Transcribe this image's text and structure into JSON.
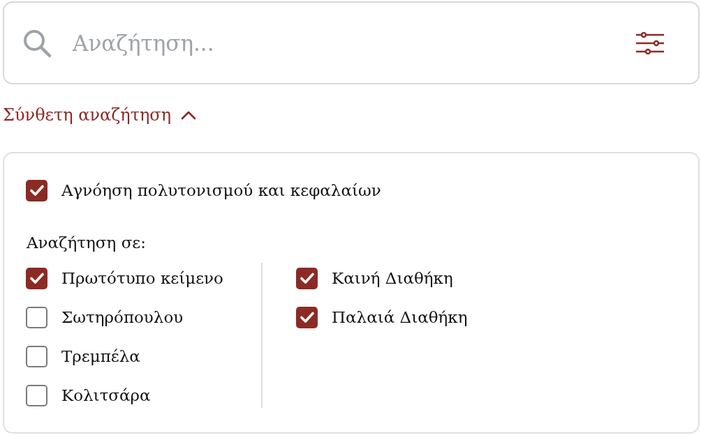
{
  "search": {
    "placeholder": "Αναζήτηση..."
  },
  "advanced_toggle": {
    "label": "Σύνθετη αναζήτηση",
    "expanded": true
  },
  "options": {
    "ignore_accents": {
      "label": "Αγνόηση πολυτονισμού και κεφαλαίων",
      "checked": true
    },
    "search_in": {
      "label": "Αναζήτηση σε:",
      "columns": [
        [
          {
            "label": "Πρωτότυπο κείμενο",
            "checked": true
          },
          {
            "label": "Σωτηρόπουλου",
            "checked": false
          },
          {
            "label": "Τρεμπέλα",
            "checked": false
          },
          {
            "label": "Κολιτσάρα",
            "checked": false
          }
        ],
        [
          {
            "label": "Καινή Διαθήκη",
            "checked": true
          },
          {
            "label": "Παλαιά Διαθήκη",
            "checked": true
          }
        ]
      ]
    }
  }
}
